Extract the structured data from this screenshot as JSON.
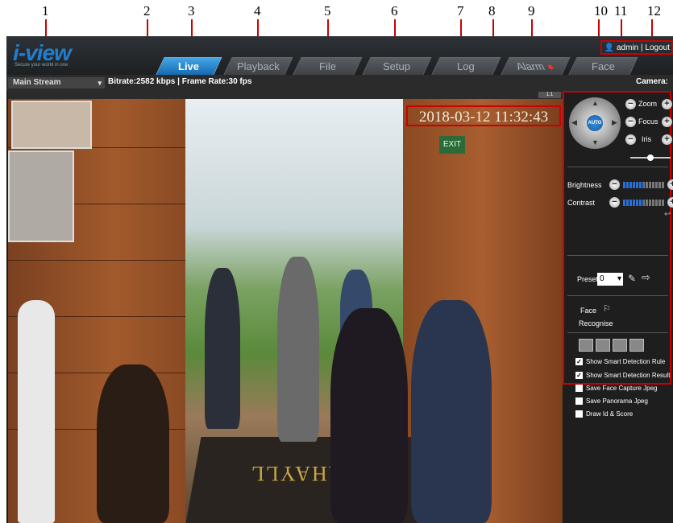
{
  "callouts": [
    "1",
    "2",
    "3",
    "4",
    "5",
    "6",
    "7",
    "8",
    "9",
    "10",
    "11",
    "12"
  ],
  "app": {
    "logo_text": "i-view",
    "logo_tagline": "Secure your world in one",
    "tabs": [
      {
        "label": "Live",
        "active": true
      },
      {
        "label": "Playback",
        "active": false
      },
      {
        "label": "File",
        "active": false
      },
      {
        "label": "Setup",
        "active": false
      },
      {
        "label": "Log",
        "active": false
      },
      {
        "label": "Alarm",
        "active": false
      },
      {
        "label": "Face",
        "active": false
      }
    ],
    "user": {
      "name": "admin",
      "separator": "|",
      "logout_label": "Logout"
    }
  },
  "toolbar": {
    "stream": "Main Stream",
    "stats": "Bitrate:2582 kbps | Frame Rate:30 fps",
    "camera_label": "Camera:"
  },
  "video": {
    "timestamp": "2018-03-12 11:32:43",
    "exit_sign": "EXIT",
    "mat_text": "MANAHAYLL",
    "resolution_badge": "1:1"
  },
  "ptz": {
    "center_label": "AUTO",
    "zoom_label": "Zoom",
    "focus_label": "Focus",
    "iris_label": "Iris",
    "speed_level": 0.45
  },
  "image": {
    "brightness_label": "Brightness",
    "brightness_level": 0.5,
    "contrast_label": "Contrast",
    "contrast_level": 0.5
  },
  "preset": {
    "label": "Preset",
    "value": "0"
  },
  "face": {
    "label": "Face",
    "recognise_label": "Recognise"
  },
  "options": [
    {
      "label": "Show Smart Detection Rule",
      "checked": true
    },
    {
      "label": "Show Smart Detection Result",
      "checked": true
    },
    {
      "label": "Save Face Capture Jpeg",
      "checked": false
    },
    {
      "label": "Save Panorama Jpeg",
      "checked": false
    },
    {
      "label": "Draw Id & Score",
      "checked": false
    }
  ],
  "colors": {
    "accent": "#1566ad",
    "highlight": "#cc0000",
    "panel_bg": "#1e1e1e"
  }
}
